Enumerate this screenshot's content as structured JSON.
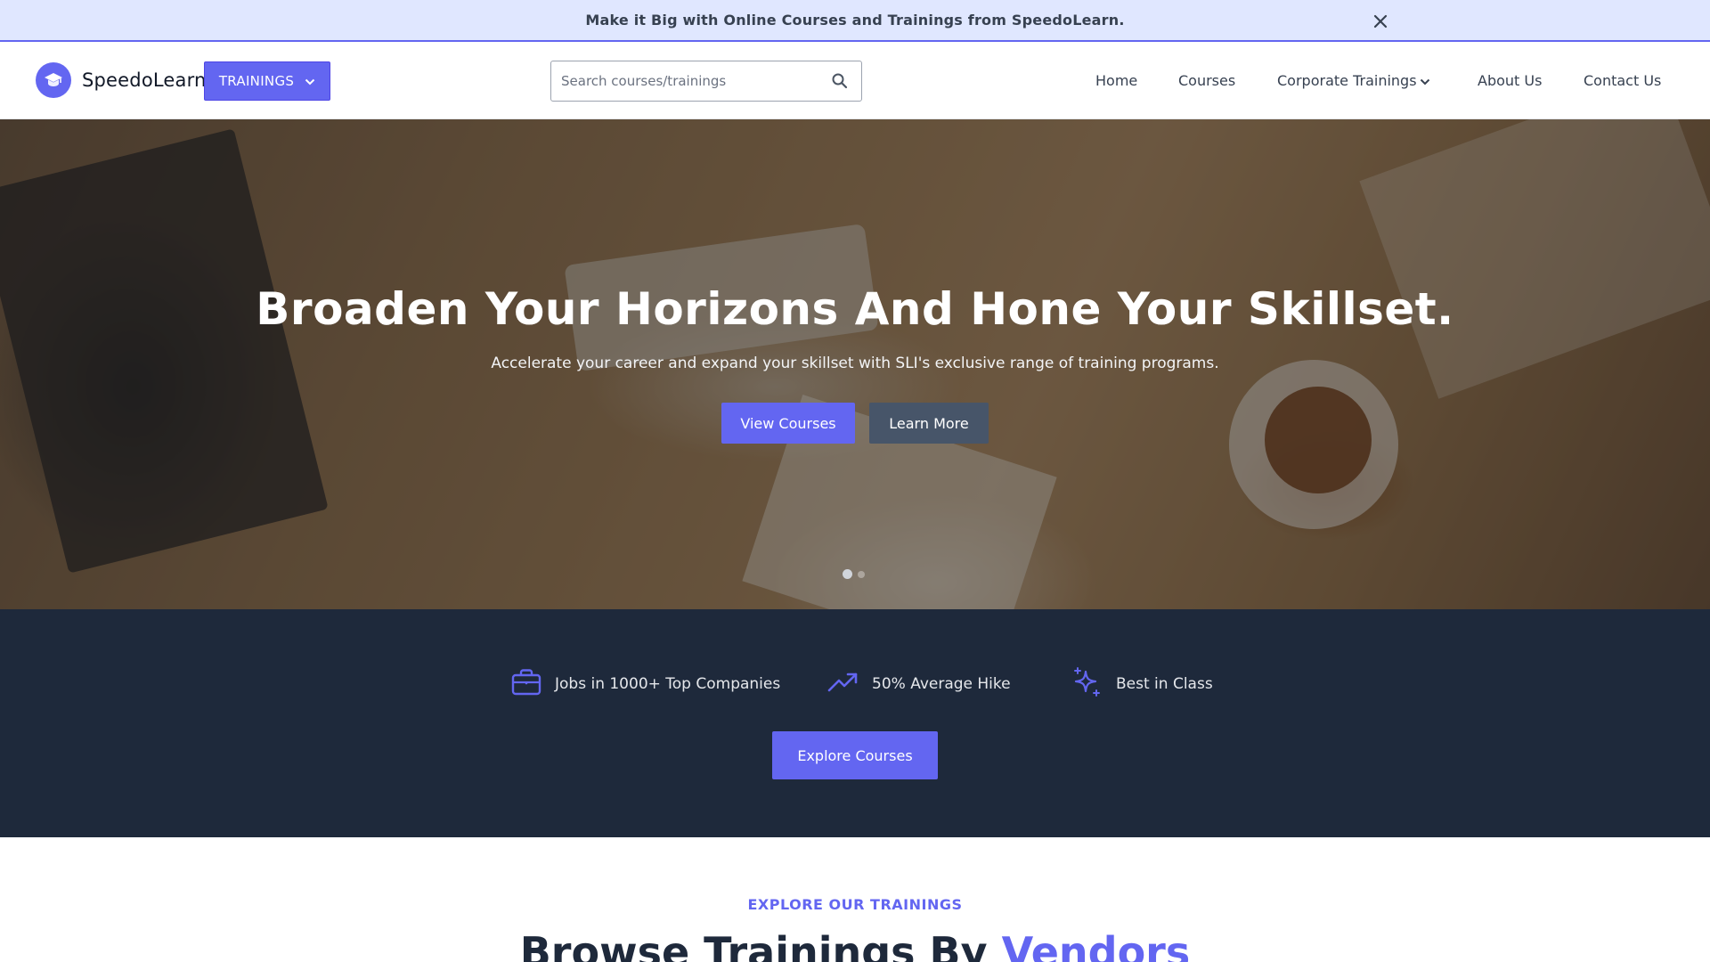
{
  "announcement": {
    "text": "Make it Big with Online Courses and Trainings from SpeedoLearn.",
    "close_icon": "close-icon"
  },
  "header": {
    "brand": "SpeedoLearn",
    "logo_icon": "graduation-cap-icon",
    "trainings_button": "TRAININGS",
    "search": {
      "placeholder": "Search courses/trainings",
      "value": ""
    },
    "nav": [
      {
        "label": "Home"
      },
      {
        "label": "Courses"
      },
      {
        "label": "Corporate Trainings",
        "has_dropdown": true
      },
      {
        "label": "About Us"
      },
      {
        "label": "Contact Us"
      }
    ]
  },
  "hero": {
    "title": "Broaden Your Horizons And Hone Your Skillset.",
    "subtitle": "Accelerate your career and expand your skillset with SLI's exclusive range of training programs.",
    "primary_button": "View Courses",
    "secondary_button": "Learn More",
    "slides_count": 2,
    "active_slide": 1
  },
  "stats": {
    "items": [
      {
        "icon": "briefcase-icon",
        "label": "Jobs in 1000+ Top Companies"
      },
      {
        "icon": "trending-up-icon",
        "label": "50% Average Hike"
      },
      {
        "icon": "sparkles-icon",
        "label": "Best in Class"
      }
    ],
    "button": "Explore Courses"
  },
  "explore": {
    "eyebrow": "EXPLORE OUR TRAININGS",
    "title_prefix": "Browse Trainings By ",
    "title_accent": "Vendors"
  },
  "colors": {
    "accent": "#6366f1",
    "announcement_bg": "#e0e7ff",
    "stats_bg": "#1e293b",
    "secondary_button": "#475569"
  }
}
